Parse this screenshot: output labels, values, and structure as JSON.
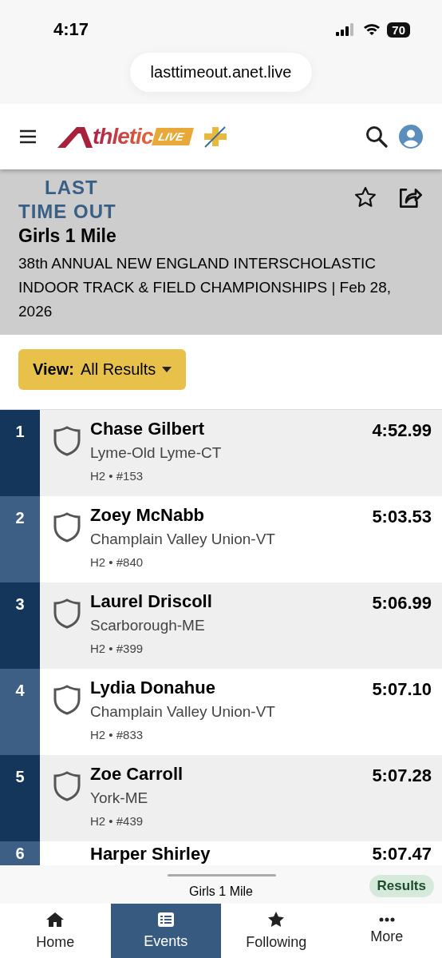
{
  "status_bar": {
    "time": "4:17",
    "battery": "70"
  },
  "browser": {
    "url": "lasttimeout.anet.live"
  },
  "header": {
    "logo_text": "thletic",
    "logo_badge": "LIVE"
  },
  "event": {
    "org_line_1": "LAST",
    "org_line_2": "TIME OUT",
    "title": "Girls 1 Mile",
    "meet": "38th ANNUAL NEW ENGLAND INTERSCHOLASTIC INDOOR TRACK & FIELD CHAMPIONSHIPS | Feb 28, 2026"
  },
  "view_button": {
    "label": "View:",
    "value": "All Results"
  },
  "results": [
    {
      "place": "1",
      "name": "Chase Gilbert",
      "team": "Lyme-Old Lyme-CT",
      "meta": "H2 • #153",
      "time": "4:52.99"
    },
    {
      "place": "2",
      "name": "Zoey McNabb",
      "team": "Champlain Valley Union-VT",
      "meta": "H2 • #840",
      "time": "5:03.53"
    },
    {
      "place": "3",
      "name": "Laurel Driscoll",
      "team": "Scarborough-ME",
      "meta": "H2 • #399",
      "time": "5:06.99"
    },
    {
      "place": "4",
      "name": "Lydia Donahue",
      "team": "Champlain Valley Union-VT",
      "meta": "H2 • #833",
      "time": "5:07.10"
    },
    {
      "place": "5",
      "name": "Zoe Carroll",
      "team": "York-ME",
      "meta": "H2 • #439",
      "time": "5:07.28"
    },
    {
      "place": "6",
      "name": "Harper Shirley",
      "time": "5:07.47"
    }
  ],
  "mini_bar": {
    "title": "Girls 1 Mile",
    "badge": "Results"
  },
  "nav": [
    {
      "kind": "home",
      "label": "Home",
      "selected": false
    },
    {
      "kind": "events",
      "label": "Events",
      "selected": true
    },
    {
      "kind": "following",
      "label": "Following",
      "selected": false
    },
    {
      "kind": "more",
      "label": "More",
      "selected": false
    }
  ]
}
